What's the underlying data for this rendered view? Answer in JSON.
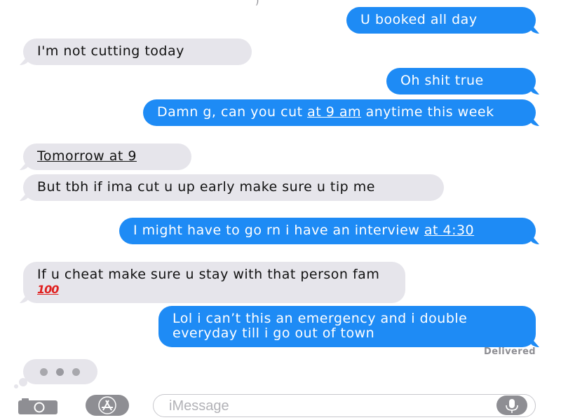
{
  "top_fragment": ")",
  "messages": [
    {
      "id": "m1",
      "side": "out",
      "lines": [
        "U booked all day"
      ]
    },
    {
      "id": "m2",
      "side": "in",
      "lines": [
        "I'm not cutting today"
      ]
    },
    {
      "id": "m3",
      "side": "out",
      "lines": [
        "Oh shit true"
      ]
    },
    {
      "id": "m4",
      "side": "out",
      "text_before": "Damn g, can you cut ",
      "link": "at 9 am",
      "text_after": " anytime this week"
    },
    {
      "id": "m5",
      "side": "in",
      "link": "Tomorrow at 9"
    },
    {
      "id": "m6",
      "side": "in",
      "lines": [
        "But tbh if ima cut u up early make sure u tip me"
      ]
    },
    {
      "id": "m7",
      "side": "out",
      "text_before": "I might have to go rn i have an interview ",
      "link": "at 4:30",
      "text_after": ""
    },
    {
      "id": "m8",
      "side": "in",
      "text_before": "If u cheat make sure u stay with that person fam ",
      "emoji": "100"
    },
    {
      "id": "m9",
      "side": "out",
      "lines": [
        "Lol i can’t this an emergency and i double everyday till i go out of town"
      ]
    }
  ],
  "status": {
    "delivered": "Delivered"
  },
  "typing_indicator": {
    "visible": true
  },
  "input_bar": {
    "placeholder": "iMessage",
    "camera_icon": "camera-icon",
    "apps_icon": "app-store-icon",
    "mic_icon": "microphone-icon"
  },
  "colors": {
    "outgoing": "#1e8bf5",
    "incoming": "#e6e5eb",
    "meta_gray": "#8e8e93"
  }
}
